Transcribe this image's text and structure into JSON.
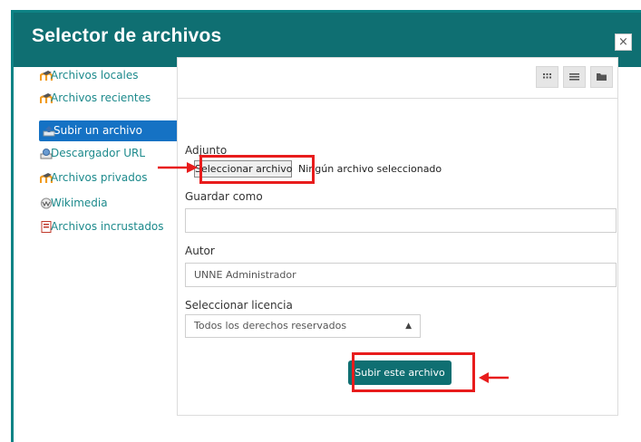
{
  "dialog": {
    "title": "Selector de archivos",
    "close_label": "×"
  },
  "sidebar": {
    "items": [
      {
        "label": "Archivos locales",
        "icon": "moodle-icon",
        "active": false
      },
      {
        "label": "Archivos recientes",
        "icon": "moodle-icon",
        "active": false
      },
      {
        "label": "Subir un archivo",
        "icon": "upload-icon",
        "active": true
      },
      {
        "label": "Descargador URL",
        "icon": "url-download-icon",
        "active": false
      },
      {
        "label": "Archivos privados",
        "icon": "moodle-icon",
        "active": false
      },
      {
        "label": "Wikimedia",
        "icon": "wikimedia-icon",
        "active": false
      },
      {
        "label": "Archivos incrustados",
        "icon": "embedded-files-icon",
        "active": false
      }
    ]
  },
  "toolbar": {
    "views": [
      "icons-view-icon",
      "list-view-icon",
      "tree-view-icon"
    ]
  },
  "form": {
    "attachment_label": "Adjunto",
    "file_button_label": "Seleccionar archivo",
    "no_file_text": "Ningún archivo seleccionado",
    "save_as_label": "Guardar como",
    "save_as_value": "",
    "author_label": "Autor",
    "author_value": "UNNE Administrador",
    "license_label": "Seleccionar licencia",
    "license_value": "Todos los derechos reservados",
    "upload_button_label": "Subir este archivo"
  },
  "colors": {
    "header": "#0f6f72",
    "link": "#1d8a8c",
    "active": "#1572c4",
    "annotation": "#e81c1c"
  }
}
